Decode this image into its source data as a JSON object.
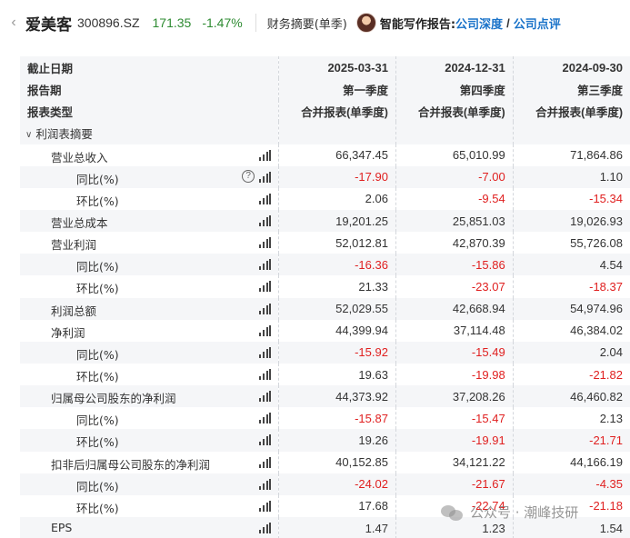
{
  "header": {
    "back_icon": "chevron-left-icon",
    "company_name": "爱美客",
    "ticker": "300896.SZ",
    "price": "171.35",
    "change_pct": "-1.47%",
    "report_mode": "财务摘要(单季)",
    "ai_label": "智能写作报告:",
    "ai_link_1": "公司深度",
    "ai_slash": "/",
    "ai_link_2": "公司点评",
    "price_color": "#2e8b32",
    "link_color": "#1a73c9"
  },
  "table": {
    "header_rows": [
      {
        "label": "截止日期",
        "values": [
          "2025-03-31",
          "2024-12-31",
          "2024-09-30"
        ]
      },
      {
        "label": "报告期",
        "values": [
          "第一季度",
          "第四季度",
          "第三季度"
        ]
      },
      {
        "label": "报表类型",
        "values": [
          "合并报表(单季度)",
          "合并报表(单季度)",
          "合并报表(单季度)"
        ]
      }
    ],
    "section_label": "利润表摘要",
    "rows": [
      {
        "label": "营业总收入",
        "level": 1,
        "values": [
          "66,347.45",
          "65,010.99",
          "71,864.86"
        ]
      },
      {
        "label": "同比(%)",
        "level": 2,
        "help": true,
        "values": [
          "-17.90",
          "-7.00",
          "1.10"
        ]
      },
      {
        "label": "环比(%)",
        "level": 2,
        "values": [
          "2.06",
          "-9.54",
          "-15.34"
        ]
      },
      {
        "label": "营业总成本",
        "level": 1,
        "values": [
          "19,201.25",
          "25,851.03",
          "19,026.93"
        ]
      },
      {
        "label": "营业利润",
        "level": 1,
        "values": [
          "52,012.81",
          "42,870.39",
          "55,726.08"
        ]
      },
      {
        "label": "同比(%)",
        "level": 2,
        "values": [
          "-16.36",
          "-15.86",
          "4.54"
        ]
      },
      {
        "label": "环比(%)",
        "level": 2,
        "values": [
          "21.33",
          "-23.07",
          "-18.37"
        ]
      },
      {
        "label": "利润总额",
        "level": 1,
        "values": [
          "52,029.55",
          "42,668.94",
          "54,974.96"
        ]
      },
      {
        "label": "净利润",
        "level": 1,
        "values": [
          "44,399.94",
          "37,114.48",
          "46,384.02"
        ]
      },
      {
        "label": "同比(%)",
        "level": 2,
        "values": [
          "-15.92",
          "-15.49",
          "2.04"
        ]
      },
      {
        "label": "环比(%)",
        "level": 2,
        "values": [
          "19.63",
          "-19.98",
          "-21.82"
        ]
      },
      {
        "label": "归属母公司股东的净利润",
        "level": 1,
        "values": [
          "44,373.92",
          "37,208.26",
          "46,460.82"
        ]
      },
      {
        "label": "同比(%)",
        "level": 2,
        "values": [
          "-15.87",
          "-15.47",
          "2.13"
        ]
      },
      {
        "label": "环比(%)",
        "level": 2,
        "values": [
          "19.26",
          "-19.91",
          "-21.71"
        ]
      },
      {
        "label": "扣非后归属母公司股东的净利润",
        "level": 1,
        "values": [
          "40,152.85",
          "34,121.22",
          "44,166.19"
        ]
      },
      {
        "label": "同比(%)",
        "level": 2,
        "values": [
          "-24.02",
          "-21.67",
          "-4.35"
        ]
      },
      {
        "label": "环比(%)",
        "level": 2,
        "values": [
          "17.68",
          "-22.74",
          "-21.18"
        ]
      },
      {
        "label": "EPS",
        "level": 1,
        "values": [
          "1.47",
          "1.23",
          "1.54"
        ]
      }
    ],
    "negative_color": "#e02020",
    "row_icon": "bar-chart-icon",
    "help_icon": "question-circle-icon",
    "section_icon": "chevron-down-icon"
  },
  "watermark": {
    "text": "公众号 · 潮峰技研",
    "icon": "wechat-icon"
  }
}
